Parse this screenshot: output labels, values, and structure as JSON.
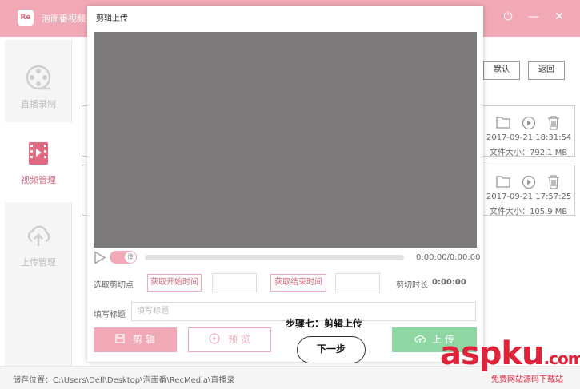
{
  "app": {
    "logo_text": "Re",
    "title": "泡面番视频录",
    "controls": [
      "✕",
      "· · ·",
      "⏻",
      "—",
      "✕"
    ]
  },
  "sidebar": {
    "items": [
      {
        "label": "直播录制",
        "icon": "film-reel-icon",
        "active": false
      },
      {
        "label": "视频管理",
        "icon": "video-file-icon",
        "active": true
      },
      {
        "label": "上传管理",
        "icon": "cloud-upload-icon",
        "active": false
      }
    ]
  },
  "content": {
    "default_button": "默认",
    "back_button": "返回",
    "videos": [
      {
        "date": "2017-09-21 18:31:54",
        "size": "文件大小：792.1 MB"
      },
      {
        "date": "2017-09-21 17:57:25",
        "size": "文件大小：105.9 MB"
      }
    ]
  },
  "dialog": {
    "title": "剪辑上传",
    "time": "0:00:00/0:00:00",
    "toggle_label": "倖",
    "cut_point_label": "选取剪切点",
    "get_start": "获取开始时间",
    "get_end": "获取结束时间",
    "clip_duration_label": "剪切时长",
    "clip_duration_value": "0:00:00",
    "title_label": "填写标题",
    "title_placeholder": "填写标题",
    "cut_button": "剪 辑",
    "preview_button": "预 览",
    "upload_button": "上 传",
    "step_text": "步骤七：剪辑上传",
    "next_button": "下一步"
  },
  "statusbar": {
    "save_location": "储存位置：C:\\Users\\Dell\\Desktop\\泡面番\\RecMedia\\直播录"
  },
  "watermark": {
    "main": "aspku",
    "domain": ".com",
    "sub": "免费网站源码下载站"
  }
}
